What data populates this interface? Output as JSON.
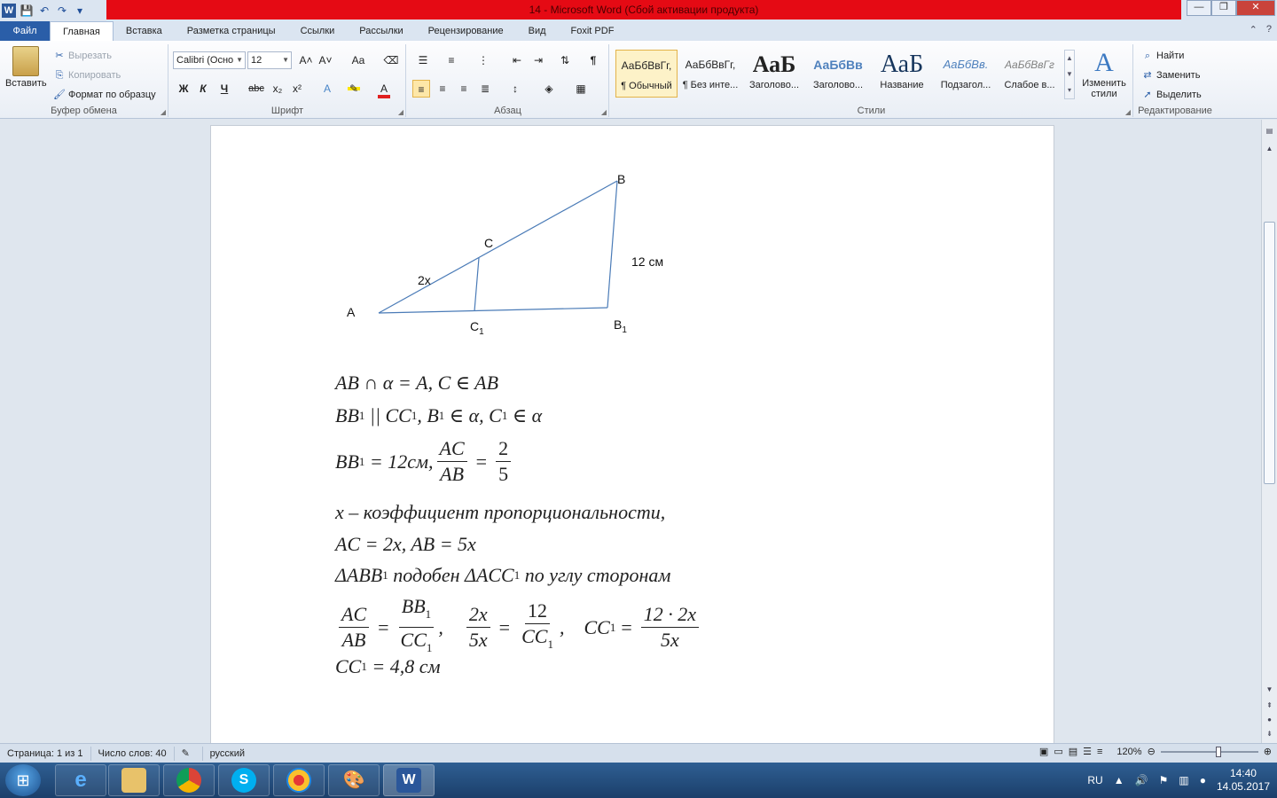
{
  "window": {
    "title": "14  -  Microsoft Word (Сбой активации продукта)",
    "minimize_glyph": "—",
    "maximize_glyph": "❐",
    "close_glyph": "✕"
  },
  "quick_access": {
    "logo": "W",
    "save": "💾",
    "undo": "↶",
    "redo": "↷",
    "customize": "▾"
  },
  "tabs": [
    "Файл",
    "Главная",
    "Вставка",
    "Разметка страницы",
    "Ссылки",
    "Рассылки",
    "Рецензирование",
    "Вид",
    "Foxit PDF"
  ],
  "active_tab_index": 1,
  "clipboard": {
    "paste": "Вставить",
    "cut": "Вырезать",
    "copy": "Копировать",
    "format_painter": "Формат по образцу",
    "group": "Буфер обмена"
  },
  "font": {
    "family": "Calibri (Осно",
    "size": "12",
    "bold": "Ж",
    "italic": "К",
    "underline": "Ч",
    "strike": "abc",
    "subscript": "x₂",
    "superscript": "x²",
    "grow": "A˄",
    "shrink": "A˅",
    "case": "Aa",
    "group": "Шрифт"
  },
  "paragraph": {
    "group": "Абзац",
    "pilcrow": "¶"
  },
  "styles": {
    "items": [
      {
        "preview": "АаБбВвГг,",
        "name": "¶ Обычный"
      },
      {
        "preview": "АаБбВвГг,",
        "name": "¶ Без инте..."
      },
      {
        "preview": "АаБ",
        "name": "Заголово..."
      },
      {
        "preview": "АаБбВв",
        "name": "Заголово..."
      },
      {
        "preview": "АаБ",
        "name": "Название"
      },
      {
        "preview": "АаБбВв.",
        "name": "Подзагол..."
      },
      {
        "preview": "АаБбВвГг",
        "name": "Слабое в..."
      }
    ],
    "change_styles": "Изменить стили",
    "group": "Стили"
  },
  "editing": {
    "find": "Найти",
    "replace": "Заменить",
    "select": "Выделить",
    "group": "Редактирование"
  },
  "figure": {
    "labels": {
      "A": "A",
      "B": "B",
      "C": "C",
      "C1": "C",
      "B1": "B",
      "sub1": "1",
      "ac": "2x",
      "bb1": "12 см"
    }
  },
  "equations": {
    "l1": "AB ∩ α = A, C ∈ AB",
    "l2a": "BB",
    "l2b": " || CC",
    "l2c": ", B",
    "l2d": " ∈ α, C",
    "l2e": " ∈ α",
    "l3a": "BB",
    "l3b": " = 12см,",
    "l3num": "AC",
    "l3den": "AB",
    "l3eq": "=",
    "l3num2": "2",
    "l3den2": "5",
    "l4": "x – коэффициент пропорциональности,",
    "l5": "AC = 2x, AB = 5x",
    "l6a": "ΔABB",
    "l6b": " подобен ΔACC",
    "l6c": " по углу сторонам",
    "l7": {
      "f1n": "AC",
      "f1d": "AB",
      "eq1": "=",
      "f2n": "BB",
      "f2d": "CC",
      "comma1": ",",
      "f3n": "2x",
      "f3d": "5x",
      "eq2": "=",
      "f4n": "12",
      "f4d": "CC",
      "comma2": ",",
      "lhs": "CC",
      "eq3": "=",
      "f5n": "12 · 2x",
      "f5d": "5x"
    },
    "l8a": "CC",
    "l8b": " = 4,8 см",
    "sub1": "1"
  },
  "status": {
    "page": "Страница: 1 из 1",
    "words": "Число слов: 40",
    "language": "русский",
    "zoom": "120%",
    "zoom_fraction": 0.6
  },
  "taskbar": {
    "apps": [
      "ie",
      "explorer",
      "chrome",
      "skype",
      "app",
      "paint",
      "word"
    ],
    "lang": "RU",
    "time": "14:40",
    "date": "14.05.2017"
  }
}
